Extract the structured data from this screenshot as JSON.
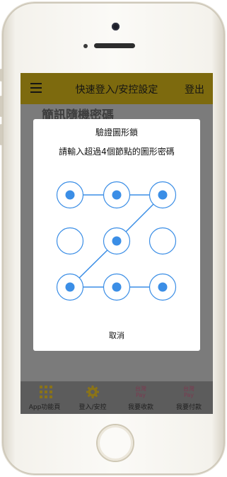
{
  "header": {
    "title": "快速登入/安控設定",
    "logout_label": "登出"
  },
  "background_title": "簡訊隨機密碼",
  "dialog": {
    "title": "驗證圖形鎖",
    "subtitle": "請輸入超過4個節點的圖形密碼",
    "cancel_label": "取消",
    "pattern": {
      "nodes_selected": [
        true,
        true,
        true,
        false,
        true,
        false,
        true,
        true,
        true
      ],
      "path": [
        1,
        2,
        3,
        5,
        7,
        8,
        9
      ],
      "accent_color": "#3b8ee6"
    }
  },
  "tabs": [
    {
      "label": "App功能頁",
      "icon": "grid-icon"
    },
    {
      "label": "登入/安控",
      "icon": "gear-icon"
    },
    {
      "label": "我要收款",
      "icon": "taiwan-pay-icon",
      "icon_text": [
        "台灣",
        "Pay"
      ]
    },
    {
      "label": "我要付款",
      "icon": "taiwan-pay-icon",
      "icon_text": [
        "台灣",
        "Pay"
      ]
    }
  ],
  "colors": {
    "header": "#7d6a0e",
    "overlay": "#7b7b7b",
    "tabbar": "#5c5c5c"
  }
}
